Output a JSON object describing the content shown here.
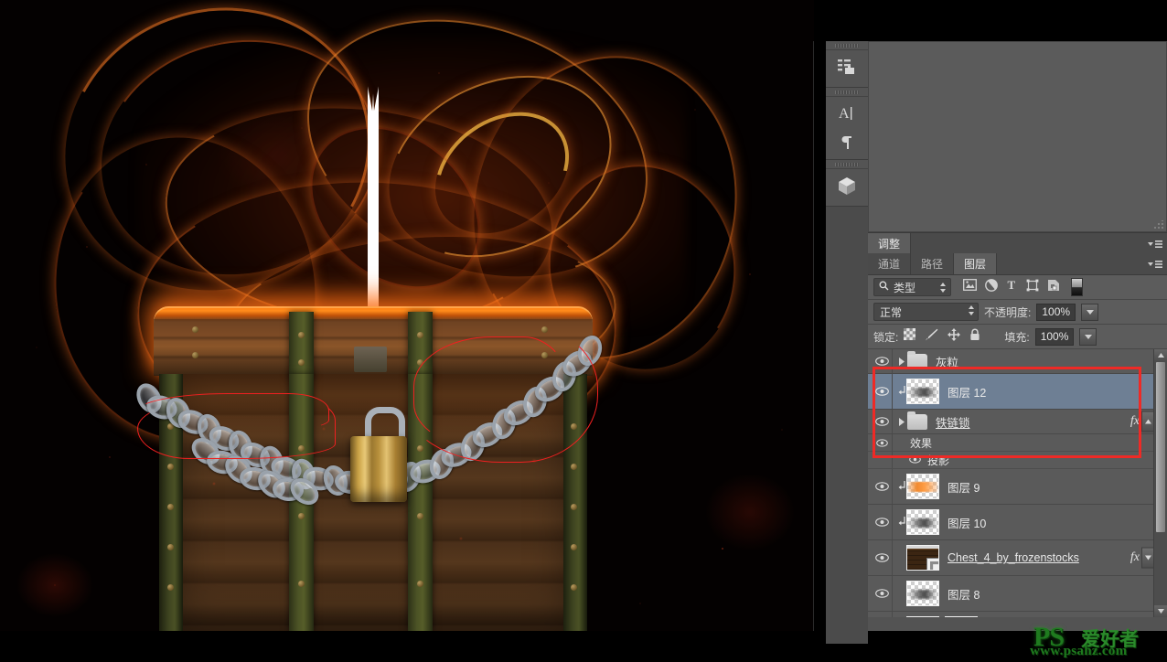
{
  "app": {
    "name": "Adobe Photoshop",
    "canvas_background": "#000000"
  },
  "icon_rail": {
    "items": [
      {
        "name": "history-icon",
        "label": "历史记录"
      },
      {
        "name": "character-icon",
        "label": "字符"
      },
      {
        "name": "paragraph-icon",
        "label": "段落"
      },
      {
        "name": "3d-icon",
        "label": "3D"
      }
    ]
  },
  "adjustments_panel": {
    "tab_label": "调整",
    "menu_icon": "panel-menu-icon",
    "resize_icon": "resize-grabber-icon"
  },
  "layers_panel": {
    "tabs": [
      {
        "label": "通道",
        "active": false
      },
      {
        "label": "路径",
        "active": false
      },
      {
        "label": "图层",
        "active": true
      }
    ],
    "menu_icon": "panel-menu-icon",
    "filter": {
      "search_icon": "search-icon",
      "value": "类型",
      "stepper_icon": "updown-stepper-icon",
      "filter_icons": [
        "pixel-layer-filter-icon",
        "adjustment-layer-filter-icon",
        "type-layer-filter-icon",
        "shape-layer-filter-icon",
        "smart-object-filter-icon"
      ],
      "toggle_icon": "filter-enable-toggle"
    },
    "blend": {
      "mode_value": "正常",
      "mode_stepper_icon": "updown-stepper-icon",
      "opacity_label": "不透明度:",
      "opacity_value": "100%",
      "opacity_dropdown_icon": "chevron-down-icon"
    },
    "lock": {
      "label": "锁定:",
      "icons": [
        "lock-transparent-pixels-icon",
        "lock-image-pixels-icon",
        "lock-position-icon",
        "lock-all-icon"
      ],
      "fill_label": "填充:",
      "fill_value": "100%",
      "fill_dropdown_icon": "chevron-down-icon"
    },
    "scrollbar": {
      "up_arrow_icon": "scroll-up-icon",
      "down_arrow_icon": "scroll-down-icon"
    },
    "layers": [
      {
        "name": "灰粒",
        "kind": "group",
        "visible": true,
        "expanded": false,
        "selected": false,
        "has_fx": false,
        "thumb": "folder",
        "clipped": false,
        "underlined": false
      },
      {
        "name": "图层 12",
        "kind": "pixel",
        "visible": true,
        "selected": true,
        "has_fx": false,
        "thumb": "checker-gray",
        "clipped": true,
        "underlined": false
      },
      {
        "name": "铁链锁",
        "kind": "group",
        "visible": true,
        "expanded": false,
        "selected": false,
        "has_fx": true,
        "fx_label": "fx",
        "thumb": "folder",
        "clipped": false,
        "underlined": true,
        "effects": {
          "label": "效果",
          "visible": true,
          "items": [
            {
              "label": "投影",
              "visible": true
            }
          ]
        }
      },
      {
        "name": "图层 9",
        "kind": "pixel",
        "visible": true,
        "selected": false,
        "has_fx": false,
        "thumb": "checker-orange",
        "clipped": true,
        "underlined": false
      },
      {
        "name": "图层 10",
        "kind": "pixel",
        "visible": true,
        "selected": false,
        "has_fx": false,
        "thumb": "checker-gray",
        "clipped": true,
        "underlined": false
      },
      {
        "name": "Chest_4_by_frozenstocks",
        "kind": "smart-object",
        "visible": true,
        "selected": false,
        "has_fx": true,
        "fx_label": "fx",
        "thumb": "wood-smart",
        "clipped": false,
        "underlined": true
      },
      {
        "name": "图层 8",
        "kind": "pixel",
        "visible": true,
        "selected": false,
        "has_fx": false,
        "thumb": "checker-gray",
        "clipped": false,
        "underlined": false
      },
      {
        "name": "",
        "kind": "pixel",
        "visible": true,
        "selected": false,
        "has_fx": false,
        "thumb": "dark-red",
        "clipped": false,
        "underlined": false
      }
    ]
  },
  "annotation": {
    "red_box_color": "#ee2a26",
    "red_box_target": "图层 12 / 铁链锁",
    "canvas_marks_color": "#ef2020"
  },
  "watermark": {
    "brand": "PS",
    "brand_cn": "爱好者",
    "url": "www.psahz.com",
    "color": "#1f7a1f"
  },
  "document": {
    "artwork_description": "treasure chest with chains and padlock, orange light swirls",
    "scrollbar_icon": "vertical-scrollbar"
  }
}
